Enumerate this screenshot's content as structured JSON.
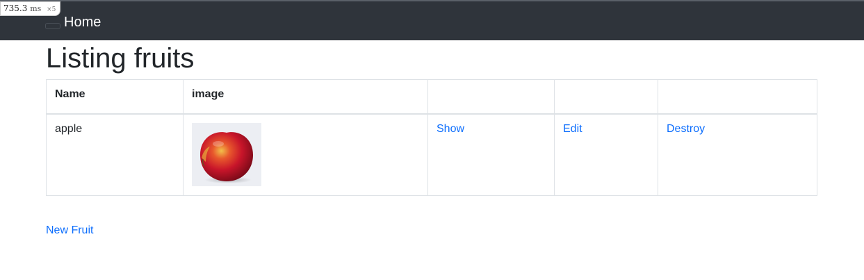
{
  "timing": {
    "value": "735.3",
    "unit": "ms",
    "count": "×5"
  },
  "navbar": {
    "brand": "Home"
  },
  "page": {
    "title": "Listing fruits"
  },
  "table": {
    "headers": [
      "Name",
      "image",
      "",
      "",
      ""
    ],
    "rows": [
      {
        "name": "apple",
        "image": "apple-photo",
        "show": "Show",
        "edit": "Edit",
        "destroy": "Destroy"
      }
    ]
  },
  "actions": {
    "new_fruit": "New Fruit"
  },
  "colors": {
    "navbar_bg": "#2f343b",
    "link": "#0d6efd",
    "border": "#dee2e6"
  }
}
